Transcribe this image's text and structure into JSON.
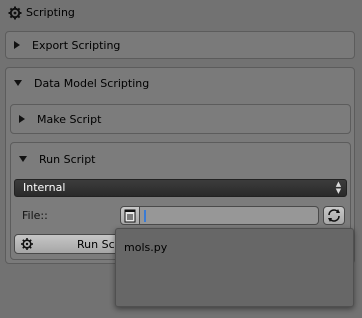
{
  "header": {
    "title": "Scripting",
    "icon": "gear-icon"
  },
  "export_panel": {
    "label": "Export Scripting",
    "expanded": false
  },
  "data_model_panel": {
    "label": "Data Model Scripting",
    "expanded": true,
    "make_script": {
      "label": "Make Script",
      "expanded": false
    },
    "run_script": {
      "label": "Run Script",
      "expanded": true,
      "source_select": {
        "value": "Internal"
      },
      "file": {
        "label": "File::",
        "value": ""
      },
      "run_button": {
        "label": "Run Scr"
      }
    }
  },
  "popup": {
    "items": [
      "mols.py"
    ]
  },
  "colors": {
    "background": "#727272",
    "dropdown": "#333333",
    "cursor": "#3a7bd5"
  }
}
